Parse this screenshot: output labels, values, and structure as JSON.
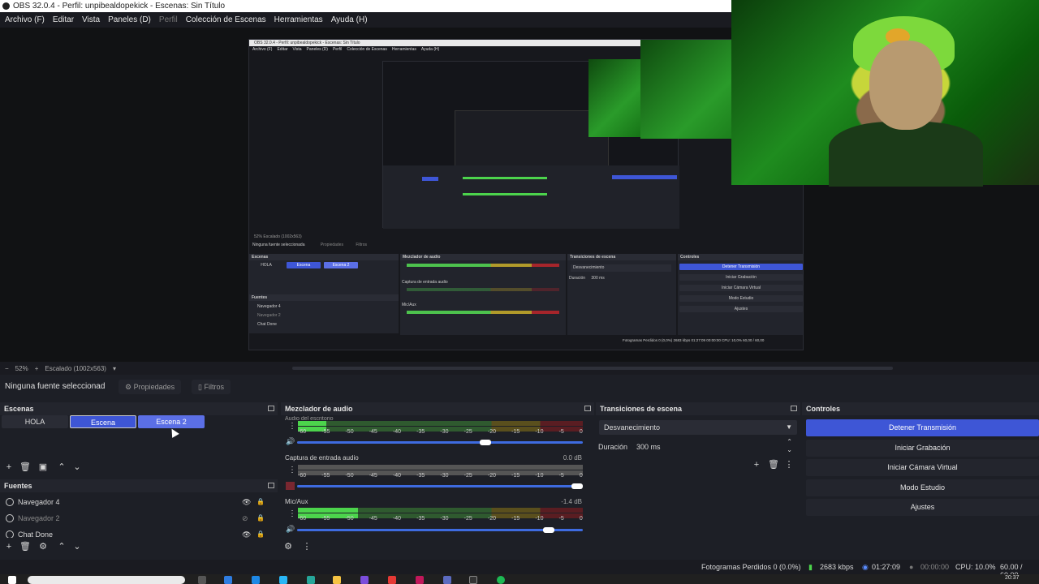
{
  "window": {
    "title": "OBS 32.0.4 - Perfil: unpibealdopekick - Escenas: Sin Título"
  },
  "menu": [
    "Archivo (F)",
    "Editar",
    "Vista",
    "Paneles (D)",
    "Perfil",
    "Colección de Escenas",
    "Herramientas",
    "Ayuda (H)"
  ],
  "preview_nested": {
    "title": "OBS 32.0.4 - Perfil: unpibealdopekick - Escenas: Sin Título",
    "menu": [
      "Archivo (F)",
      "Editar",
      "Vista",
      "Paneles (D)",
      "Perfil",
      "Colección de Escenas",
      "Herramientas",
      "Ayuda (H)"
    ],
    "zoom": "52%",
    "scaled": "Escalado (1002x563)",
    "no_source": "Ninguna fuente seleccionada",
    "properties": "Propiedades",
    "filters": "Filtros",
    "scenes_title": "Escenas",
    "scenes": [
      "HOLA",
      "Escena",
      "Escena 2"
    ],
    "sources_title": "Fuentes",
    "sources": [
      "Navegador 4",
      "Navegador 2",
      "Chat Done"
    ],
    "mixer_title": "Mezclador de audio",
    "mix_capture": "Captura de entrada audio",
    "mix_mic": "Mic/Aux",
    "transitions_title": "Transiciones de escena",
    "transition": "Desvanecimiento",
    "duration_label": "Duración",
    "duration": "300 ms",
    "controls_title": "Controles",
    "controls": [
      "Detener Transmisión",
      "Iniciar Grabación",
      "Iniciar Cámara Virtual",
      "Modo Estudio",
      "Ajustes"
    ],
    "status": "Fotogramas Perdidos 0 (0,0%)   2683 kbps   01:27:09   00:00:00   CPU: 10,0%   60,00 / 60,00"
  },
  "zoombar": {
    "minus": "−",
    "zoom": "52%",
    "plus": "+",
    "scaled": "Escalado (1002x563)"
  },
  "propbar": {
    "no_source": "Ninguna fuente seleccionad",
    "properties": "Propiedades",
    "filters": "Filtros"
  },
  "scenes": {
    "title": "Escenas",
    "items": [
      {
        "label": "HOLA",
        "state": "normal"
      },
      {
        "label": "Escena",
        "state": "active"
      },
      {
        "label": "Escena 2",
        "state": "hover"
      }
    ]
  },
  "sources": {
    "title": "Fuentes",
    "items": [
      {
        "label": "Navegador 4",
        "visible": true
      },
      {
        "label": "Navegador 2",
        "visible": false
      },
      {
        "label": "Chat Done",
        "visible": true
      }
    ]
  },
  "mixer": {
    "title": "Mezclador de audio",
    "ticks": [
      "-60",
      "-55",
      "-50",
      "-45",
      "-40",
      "-35",
      "-30",
      "-25",
      "-20",
      "-15",
      "-10",
      "-5",
      "0"
    ],
    "channels": [
      {
        "name": "Audio del escritorio",
        "db": "",
        "level": 0.1,
        "volume": 0.68,
        "muted": false
      },
      {
        "name": "Captura de entrada audio",
        "db": "0.0 dB",
        "level": 0.0,
        "volume": 1.0,
        "muted": true
      },
      {
        "name": "Mic/Aux",
        "db": "-1.4 dB",
        "level": 0.21,
        "volume": 0.9,
        "muted": false
      }
    ]
  },
  "transitions": {
    "title": "Transiciones de escena",
    "selected": "Desvanecimiento",
    "duration_label": "Duración",
    "duration": "300 ms"
  },
  "controls": {
    "title": "Controles",
    "buttons": [
      {
        "label": "Detener Transmisión",
        "active": true
      },
      {
        "label": "Iniciar Grabación",
        "active": false
      },
      {
        "label": "Iniciar Cámara Virtual",
        "active": false
      },
      {
        "label": "Modo Estudio",
        "active": false
      },
      {
        "label": "Ajustes",
        "active": false
      }
    ]
  },
  "status": {
    "dropped": "Fotogramas Perdidos 0 (0.0%)",
    "bitrate": "2683 kbps",
    "stream_time": "01:27:09",
    "rec_time": "00:00:00",
    "cpu": "CPU: 10.0%",
    "fps": "60.00 / 60.00"
  },
  "taskbar": {
    "clock": "20:37"
  },
  "colors": {
    "accent": "#3e56d6",
    "panel": "#1d1f26",
    "meter_green": "#4cd44c",
    "meter_yellow": "#b19a2a",
    "meter_red": "#a6252b"
  }
}
